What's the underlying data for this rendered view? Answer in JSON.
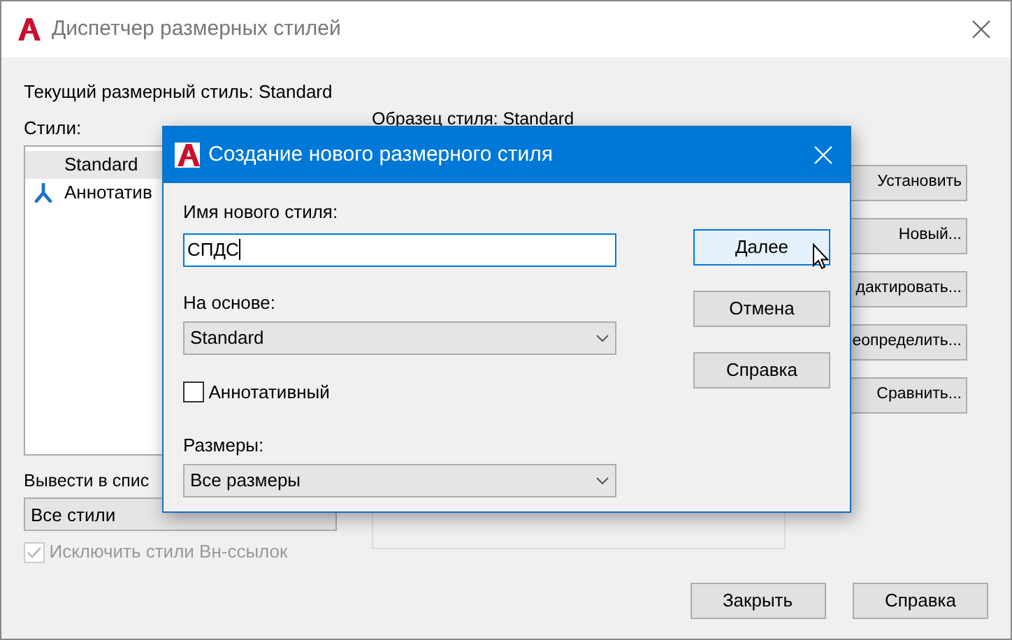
{
  "window": {
    "title": "Диспетчер размерных стилей"
  },
  "current_style": "Текущий размерный стиль: Standard",
  "styles": {
    "label": "Стили:",
    "items": [
      {
        "name": "Standard",
        "annotative": false,
        "selected": true
      },
      {
        "name": "Аннотатив",
        "annotative": true,
        "selected": false
      }
    ]
  },
  "preview": {
    "label": "Образец стиля: Standard"
  },
  "side_buttons": [
    "Установить",
    "Новый...",
    "дактировать...",
    "еопределить...",
    "Сравнить..."
  ],
  "list_filter": {
    "label": "Вывести в спис",
    "value": "Все стили"
  },
  "exclude_xref": {
    "label": "Исключить стили Вн-ссылок",
    "checked": true,
    "disabled": true
  },
  "footer_buttons": [
    "Закрыть",
    "Справка"
  ],
  "dialog": {
    "title": "Создание нового размерного стиля",
    "name_label": "Имя нового стиля:",
    "name_value": "СПДС",
    "based_on_label": "На основе:",
    "based_on_value": "Standard",
    "annotative": {
      "label": "Аннотативный",
      "checked": false
    },
    "use_for_label": "Размеры:",
    "use_for_value": "Все размеры",
    "buttons": [
      {
        "label": "Далее",
        "hovered": true
      },
      {
        "label": "Отмена",
        "hovered": false
      },
      {
        "label": "Справка",
        "hovered": false
      }
    ]
  }
}
